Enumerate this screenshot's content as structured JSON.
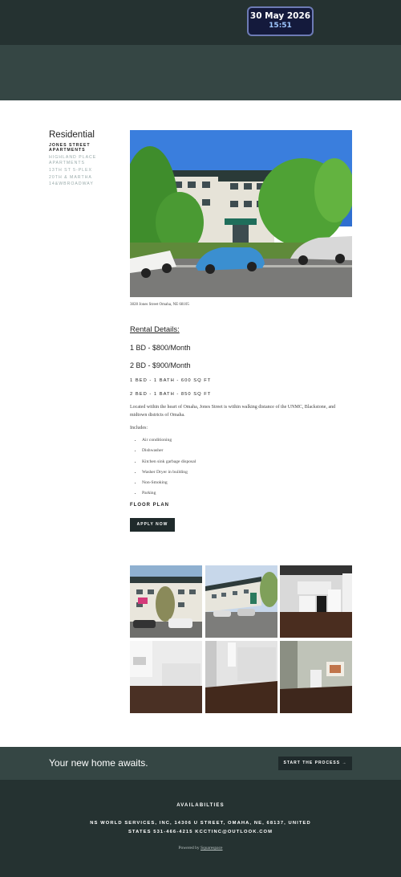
{
  "clock": {
    "date": "30 May 2026",
    "time": "15:51"
  },
  "sidebar": {
    "title": "Residential",
    "items": [
      {
        "label": "JONES STREET APARTMENTS",
        "active": true
      },
      {
        "label": "HIGHLAND PLACE APARTMENTS",
        "active": false
      },
      {
        "label": "13TH ST 5-PLEX",
        "active": false
      },
      {
        "label": "20TH & MARTHA",
        "active": false
      },
      {
        "label": "14&WBROADWAY",
        "active": false
      }
    ]
  },
  "listing": {
    "caption": "3828 Jones Street Omaha, NE 68105",
    "rental_title": "Rental Details:",
    "price_1": "1 BD - $800/Month",
    "price_2": "2 BD - $900/Month",
    "spec_1": "1 BED - 1 BATH - 600 SQ FT",
    "spec_2": "2 BED - 1 BATH - 850 SQ FT",
    "description": "Located within the heart of Omaha, Jones Street is within walking distance of the UNMC, Blackstone, and midtown districts of Omaha.",
    "includes_label": "Includes:",
    "amenities": [
      "Air conditioning",
      "Dishwasher",
      "Kitchen sink garbage disposal",
      "Washer Dryer in building",
      "Non-Smoking",
      "Parking"
    ],
    "floor_plan": "FLOOR PLAN",
    "apply_label": "APPLY NOW"
  },
  "cta": {
    "text": "Your new home awaits.",
    "button": "START THE PROCESS →"
  },
  "footer": {
    "heading": "AVAILABILTIES",
    "address_line_1": "NS WORLD SERVICES, INC, 14306 U STREET, OMAHA, NE, 68137, UNITED",
    "address_line_2": "STATES   531-466-4215   KCCTINC@OUTLOOK.COM",
    "powered_prefix": "Powered by ",
    "powered_link": "Squarespace"
  },
  "colors": {
    "topbar": "#253231",
    "hero": "#354644",
    "button": "#1f2a2b",
    "clock_bg": "#141a3c"
  }
}
